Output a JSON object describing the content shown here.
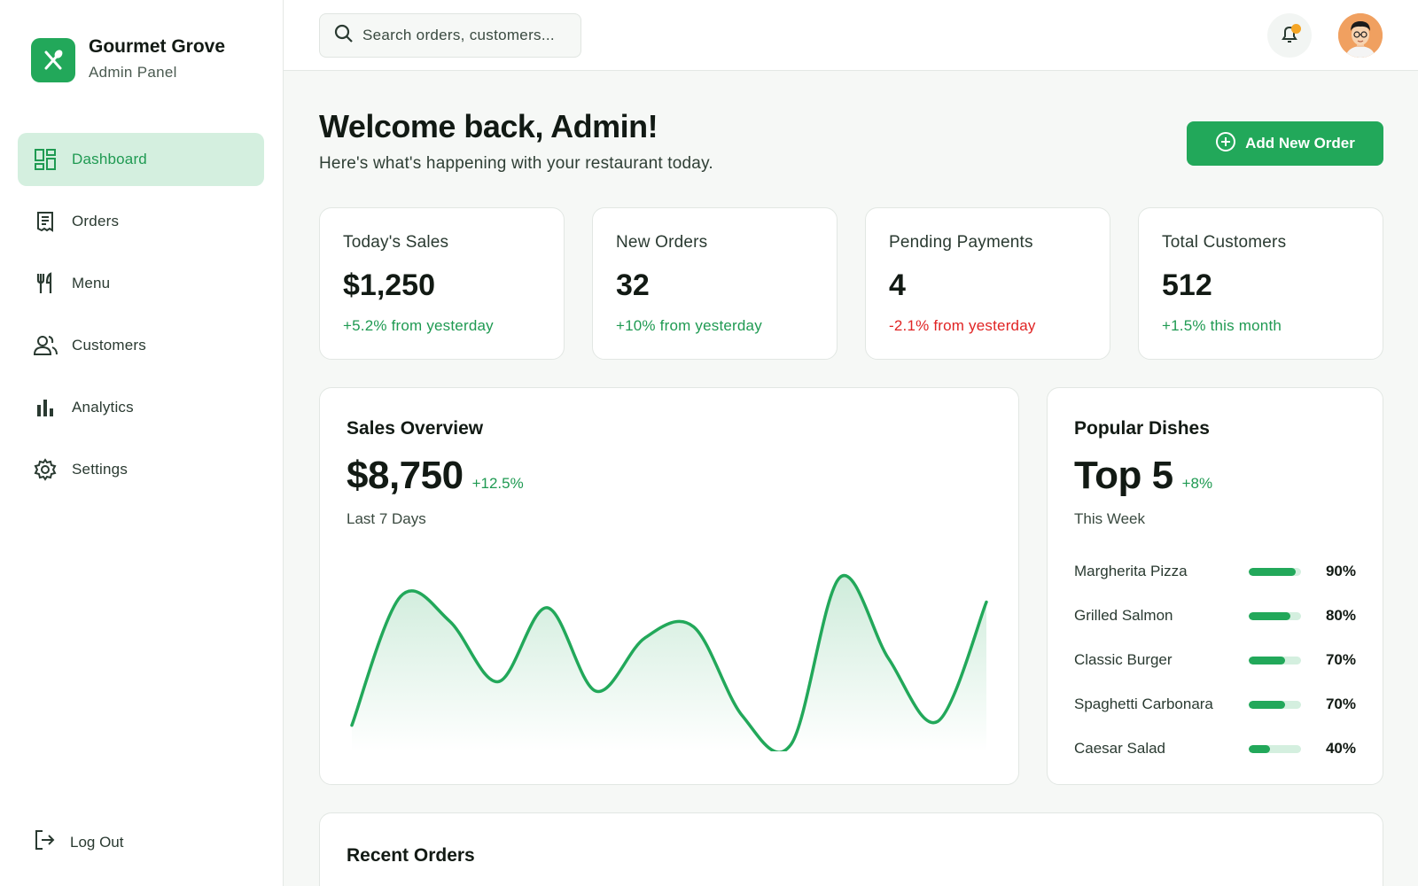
{
  "brand": {
    "name": "Gourmet Grove",
    "subtitle": "Admin Panel"
  },
  "nav": {
    "items": [
      {
        "label": "Dashboard",
        "icon": "dashboard-icon",
        "active": true
      },
      {
        "label": "Orders",
        "icon": "receipt-icon"
      },
      {
        "label": "Menu",
        "icon": "utensils-icon"
      },
      {
        "label": "Customers",
        "icon": "users-icon"
      },
      {
        "label": "Analytics",
        "icon": "bar-chart-icon"
      },
      {
        "label": "Settings",
        "icon": "gear-icon"
      }
    ],
    "logout": "Log Out"
  },
  "header": {
    "search_placeholder": "Search orders, customers..."
  },
  "welcome": {
    "title": "Welcome back, Admin!",
    "subtitle": "Here's what's happening with your restaurant today.",
    "add_button": "Add New Order"
  },
  "stats": [
    {
      "label": "Today's Sales",
      "value": "$1,250",
      "delta": "+5.2% from yesterday",
      "trend": "up"
    },
    {
      "label": "New Orders",
      "value": "32",
      "delta": "+10% from yesterday",
      "trend": "up"
    },
    {
      "label": "Pending Payments",
      "value": "4",
      "delta": "-2.1% from yesterday",
      "trend": "down"
    },
    {
      "label": "Total Customers",
      "value": "512",
      "delta": "+1.5% this month",
      "trend": "up"
    }
  ],
  "sales": {
    "title": "Sales Overview",
    "value": "$8,750",
    "delta": "+12.5%",
    "period": "Last 7 Days"
  },
  "dishes": {
    "title": "Popular Dishes",
    "value": "Top 5",
    "delta": "+8%",
    "period": "This Week",
    "items": [
      {
        "name": "Margherita Pizza",
        "pct": "90%",
        "level": 0.9
      },
      {
        "name": "Grilled Salmon",
        "pct": "80%",
        "level": 0.8
      },
      {
        "name": "Classic Burger",
        "pct": "70%",
        "level": 0.7
      },
      {
        "name": "Spaghetti Carbonara",
        "pct": "70%",
        "level": 0.7
      },
      {
        "name": "Caesar Salad",
        "pct": "40%",
        "level": 0.4
      }
    ]
  },
  "recent": {
    "title": "Recent Orders"
  },
  "colors": {
    "accent": "#22a85a",
    "accent_light": "#d4efdf",
    "negative": "#e02424",
    "notification": "#f5a524"
  },
  "chart_data": {
    "type": "area",
    "x": [
      0,
      1,
      2,
      3,
      4,
      5,
      6,
      7,
      8,
      9,
      10,
      11,
      12,
      13
    ],
    "values": [
      10,
      78,
      65,
      33,
      72,
      28,
      56,
      62,
      15,
      0,
      88,
      45,
      12,
      75
    ],
    "ylim": [
      0,
      100
    ],
    "grid": false
  }
}
